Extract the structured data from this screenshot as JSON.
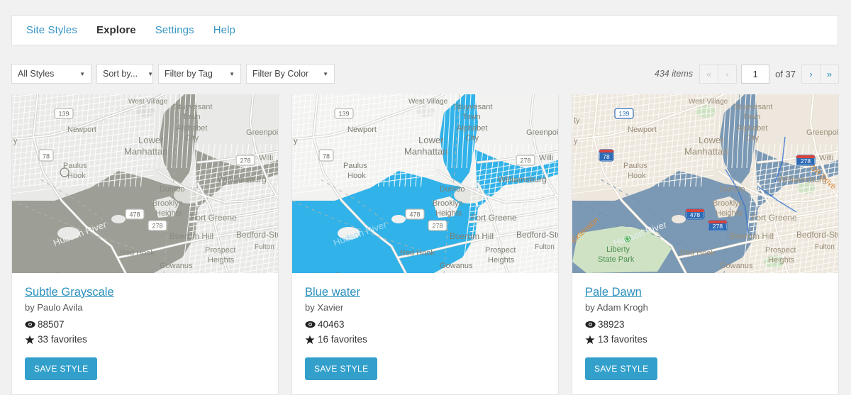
{
  "nav": {
    "items": [
      {
        "label": "Site Styles",
        "active": false
      },
      {
        "label": "Explore",
        "active": true
      },
      {
        "label": "Settings",
        "active": false
      },
      {
        "label": "Help",
        "active": false
      }
    ]
  },
  "toolbar": {
    "filters": [
      {
        "name": "all-styles",
        "label": "All Styles"
      },
      {
        "name": "sort-by",
        "label": "Sort by..."
      },
      {
        "name": "filter-by-tag",
        "label": "Filter by Tag"
      },
      {
        "name": "filter-by-color",
        "label": "Filter By Color"
      }
    ],
    "arrow_glyph": "▼"
  },
  "pagination": {
    "item_count": "434 items",
    "first_glyph": "«",
    "prev_glyph": "‹",
    "current_page": "1",
    "of_label": "of 37",
    "next_glyph": "›",
    "last_glyph": "»"
  },
  "icons": {
    "eye": "eye-icon",
    "star": "star-icon"
  },
  "cards": [
    {
      "title": "Subtle Grayscale",
      "author": "by Paulo Avila",
      "views": "88507",
      "favorites": "33 favorites",
      "save_label": "SAVE STYLE",
      "theme": "grayscale",
      "colors": {
        "land": "#e9e9e7",
        "water": "#9d9e96",
        "park": "#dcdcd8",
        "road": "#ffffff",
        "road_major": "#c9c9c4",
        "label": "#8b8b80",
        "shield": "#ffffff",
        "shield_text": "#6f6f66"
      },
      "map_labels": [
        "139",
        "Newport",
        "78",
        "Paulus Hook",
        "Lower Manhattan",
        "Stuyvesant Town",
        "Alphabet City",
        "Greenpoi",
        "Willi",
        "Williamsburg",
        "278",
        "Dumbo",
        "Brooklyn Heights",
        "Fort Greene",
        "Boerum Hill",
        "Bedford-Stuy",
        "Fulton",
        "Prospect Heights",
        "Gowanus",
        "478",
        "Red Hook",
        "Hudson River",
        "y"
      ]
    },
    {
      "title": "Blue water",
      "author": "by Xavier",
      "views": "40463",
      "favorites": "16 favorites",
      "save_label": "SAVE STYLE",
      "theme": "bluewater",
      "colors": {
        "land": "#f2f2f0",
        "water": "#31b2e8",
        "park": "#e6e6e2",
        "road": "#ffffff",
        "road_major": "#cfcfca",
        "label": "#7d7d74",
        "shield": "#ffffff",
        "shield_text": "#6f6f66"
      },
      "map_labels": [
        "139",
        "Newport",
        "78",
        "Paulus Hook",
        "Lower Manhattan",
        "Stuyvesant Town",
        "Alphabet City",
        "Greenpoi",
        "Willi",
        "Williamsburg",
        "278",
        "Dumbo",
        "Brooklyn Heights",
        "Fort Greene",
        "Boerum Hill",
        "Bedford-Stuy",
        "Fulton",
        "Prospect Heights",
        "Gowanus",
        "478",
        "Red Hook",
        "y"
      ]
    },
    {
      "title": "Pale Dawn",
      "author": "by Adam Krogh",
      "views": "38923",
      "favorites": "13 favorites",
      "save_label": "SAVE STYLE",
      "theme": "paledawn",
      "colors": {
        "land": "#ede7dd",
        "water": "#7b99b4",
        "park": "#cfe3c4",
        "road": "#fdfcf8",
        "road_major": "#e3d9c7",
        "label": "#9b8f7a",
        "shield": "#ffffff",
        "shield_text": "#3b6fb5",
        "accent_road": "#d98a3a",
        "interstate_red": "#d7443e",
        "interstate_blue": "#2d6bb5"
      },
      "map_labels": [
        "139",
        "Newport",
        "78",
        "Paulus Hook",
        "Lower Manhattan",
        "Stuyvesant Town",
        "Alphabet City",
        "Greenpoi",
        "Willi",
        "Williamsburg",
        "278",
        "Dumbo",
        "Brooklyn Heights",
        "Fort Greene",
        "Boerum Hill",
        "Bedford-Stuy",
        "Fulton",
        "Prospect Heights",
        "Gowanus",
        "478",
        "Red Hook",
        "Liberty State Park",
        "Extension",
        "FDR Drive",
        "ty"
      ]
    }
  ]
}
